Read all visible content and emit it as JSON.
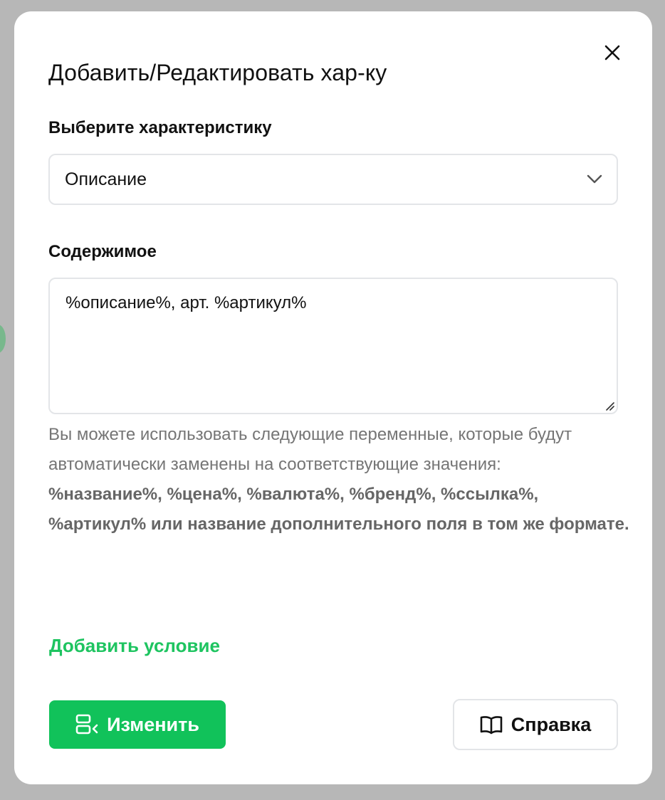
{
  "modal": {
    "title": "Добавить/Редактировать хар-ку",
    "close_icon": "close-icon"
  },
  "characteristic": {
    "label": "Выберите характеристику",
    "selected": "Описание",
    "icon": "chevron-down-icon"
  },
  "content": {
    "label": "Содержимое",
    "value": "%описание%, арт. %артикул%"
  },
  "hint": {
    "text": "Вы можете использовать следующие переменные, которые будут автоматически заменены на соответствующие значения:",
    "variables": "%название%, %цена%, %валюта%, %бренд%, %ссылка%, %артикул% или название дополнительного поля в том же формате."
  },
  "add_condition_label": "Добавить условие",
  "buttons": {
    "submit_label": "Изменить",
    "submit_icon": "edit-layout-icon",
    "help_label": "Справка",
    "help_icon": "book-icon"
  },
  "colors": {
    "accent": "#11c25a",
    "link": "#1ec460",
    "border": "#e3e5e8",
    "overlay": "#b7b7b7"
  }
}
